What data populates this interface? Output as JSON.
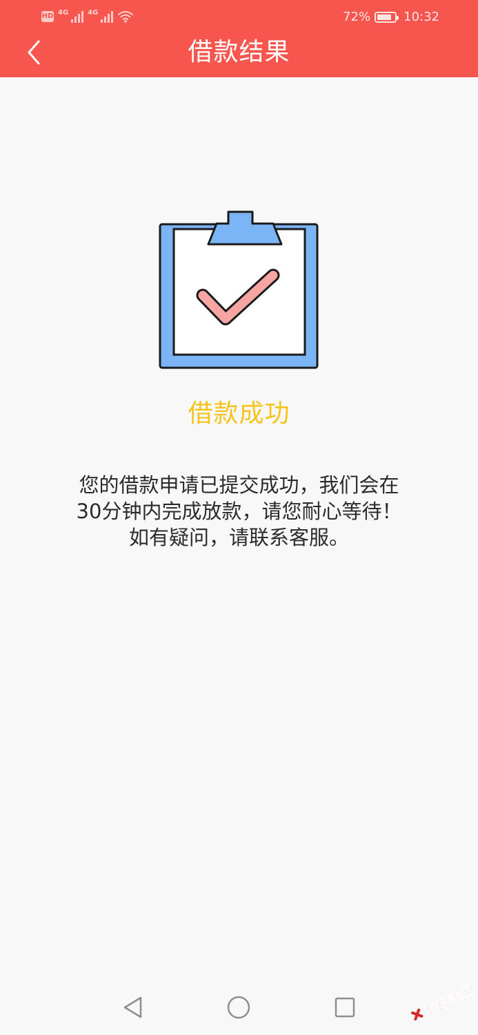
{
  "status_bar": {
    "hd_label": "HD",
    "network_1": "4G",
    "network_2": "4G",
    "battery": "72%",
    "time": "10:32"
  },
  "header": {
    "title": "借款结果",
    "back_icon": "chevron-left-icon",
    "background_color": "#f7564f"
  },
  "result": {
    "icon": "clipboard-check-icon",
    "title": "借款成功",
    "title_color": "#f4c41c",
    "message_lines": [
      "您的借款申请已提交成功，我们会在",
      "30分钟内完成放款，请您耐心等待！",
      "如有疑问，请联系客服。"
    ]
  },
  "nav_bar": {
    "back_icon": "triangle-back-icon",
    "home_icon": "circle-home-icon",
    "recent_icon": "square-recents-icon"
  },
  "watermark": {
    "text": "卡农社区"
  }
}
